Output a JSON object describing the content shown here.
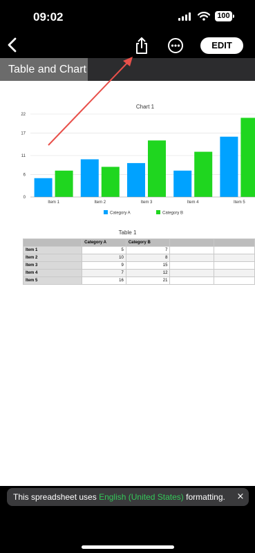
{
  "status_bar": {
    "time": "09:02",
    "battery": "100"
  },
  "nav": {
    "edit_label": "EDIT",
    "icons": [
      "chevron-left-icon",
      "share-icon",
      "ellipsis-circle-icon"
    ]
  },
  "sheet": {
    "tab_label": "Table and Chart"
  },
  "chart_data": {
    "type": "bar",
    "title": "Chart 1",
    "categories": [
      "Item 1",
      "Item 2",
      "Item 3",
      "Item 4",
      "Item 5"
    ],
    "series": [
      {
        "name": "Category A",
        "values": [
          5,
          10,
          9,
          7,
          16
        ],
        "color": "#00a2ff"
      },
      {
        "name": "Category B",
        "values": [
          7,
          8,
          15,
          12,
          21
        ],
        "color": "#1fd61f"
      }
    ],
    "yticks": [
      "0",
      "6",
      "11",
      "17",
      "22"
    ],
    "ylim": [
      0,
      22
    ],
    "grid": true,
    "legend": "bottom"
  },
  "table": {
    "title": "Table 1",
    "headers": [
      "",
      "Category A",
      "Category B",
      "",
      ""
    ],
    "rows": [
      [
        "Item 1",
        "5",
        "7",
        "",
        ""
      ],
      [
        "Item 2",
        "10",
        "8",
        "",
        ""
      ],
      [
        "Item 3",
        "9",
        "15",
        "",
        ""
      ],
      [
        "Item 4",
        "7",
        "12",
        "",
        ""
      ],
      [
        "Item 5",
        "16",
        "21",
        "",
        ""
      ]
    ]
  },
  "toast": {
    "prefix": "This spreadsheet uses ",
    "language": "English (United States)",
    "suffix": " formatting.",
    "close": "×"
  },
  "colors": {
    "accent_green": "#34c759",
    "annotation_arrow": "#e8504a"
  }
}
